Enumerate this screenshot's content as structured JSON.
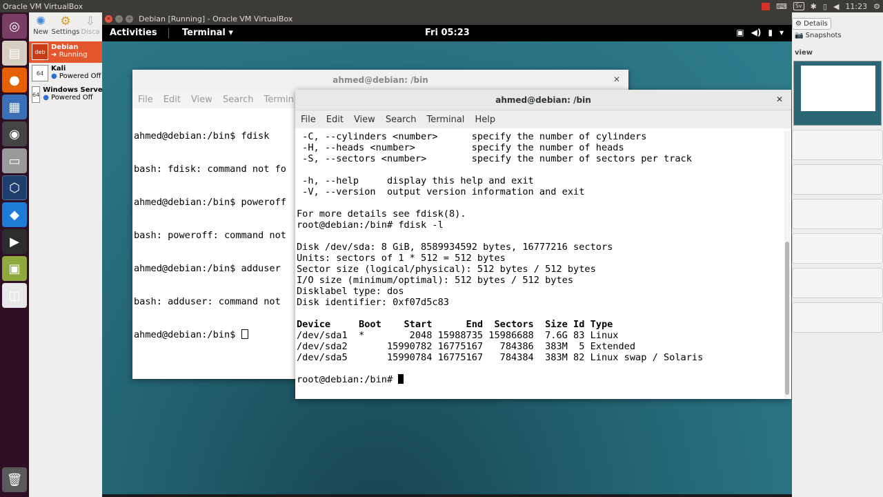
{
  "host": {
    "title": "Oracle VM VirtualBox",
    "tray": {
      "badge": "Sv",
      "time": "11:23"
    }
  },
  "launcher": {
    "items": [
      {
        "name": "ubuntu-dash-icon",
        "glyph": "◎",
        "color": "#7a3d63"
      },
      {
        "name": "files-icon",
        "glyph": "▤",
        "color": "#d7d0c2"
      },
      {
        "name": "firefox-icon",
        "glyph": "●",
        "color": "#e66000"
      },
      {
        "name": "writer-icon",
        "glyph": "▦",
        "color": "#3b6fb6"
      },
      {
        "name": "chat-icon",
        "glyph": "◉",
        "color": "#444444"
      },
      {
        "name": "disk-icon",
        "glyph": "▭",
        "color": "#9a9a9a"
      },
      {
        "name": "virtualbox-icon",
        "glyph": "⬡",
        "color": "#1d3e6e"
      },
      {
        "name": "vscode-icon",
        "glyph": "◆",
        "color": "#1e7bd6"
      },
      {
        "name": "terminal-icon",
        "glyph": "▶",
        "color": "#2c2c2c"
      },
      {
        "name": "archive-icon",
        "glyph": "▣",
        "color": "#8fa93f"
      },
      {
        "name": "pdf-icon",
        "glyph": "◫",
        "color": "#e8e8e8"
      }
    ]
  },
  "vbox": {
    "toolbar": {
      "new_label": "New",
      "settings_label": "Settings",
      "discard_label": "Disca"
    },
    "vms": [
      {
        "name": "Debian",
        "state": "Running",
        "logo": "deb"
      },
      {
        "name": "Kali",
        "state": "Powered Off",
        "logo": "64"
      },
      {
        "name": "Windows Serve",
        "state": "Powered Off",
        "logo": "64"
      }
    ],
    "right": {
      "details_tab": "Details",
      "snapshots_tab": "Snapshots",
      "preview_label": "view"
    }
  },
  "vm_window": {
    "title": "Debian [Running] - Oracle VM VirtualBox"
  },
  "gnome": {
    "activities": "Activities",
    "app_menu": "Terminal ▾",
    "clock": "Fri 05:23"
  },
  "term_back": {
    "title": "ahmed@debian: /bin",
    "menu": [
      "File",
      "Edit",
      "View",
      "Search",
      "Termin"
    ],
    "lines": [
      "ahmed@debian:/bin$ fdisk",
      "bash: fdisk: command not fo",
      "ahmed@debian:/bin$ poweroff",
      "bash: poweroff: command not",
      "ahmed@debian:/bin$ adduser",
      "bash: adduser: command not ",
      "ahmed@debian:/bin$ "
    ]
  },
  "term_front": {
    "title": "ahmed@debian: /bin",
    "menu": [
      "File",
      "Edit",
      "View",
      "Search",
      "Terminal",
      "Help"
    ],
    "lines": [
      " -C, --cylinders <number>      specify the number of cylinders",
      " -H, --heads <number>          specify the number of heads",
      " -S, --sectors <number>        specify the number of sectors per track",
      "",
      " -h, --help     display this help and exit",
      " -V, --version  output version information and exit",
      "",
      "For more details see fdisk(8).",
      "root@debian:/bin# fdisk -l",
      "",
      "Disk /dev/sda: 8 GiB, 8589934592 bytes, 16777216 sectors",
      "Units: sectors of 1 * 512 = 512 bytes",
      "Sector size (logical/physical): 512 bytes / 512 bytes",
      "I/O size (minimum/optimal): 512 bytes / 512 bytes",
      "Disklabel type: dos",
      "Disk identifier: 0xf07d5c83",
      "",
      "Device     Boot    Start      End  Sectors  Size Id Type",
      "/dev/sda1  *        2048 15988735 15986688  7.6G 83 Linux",
      "/dev/sda2       15990782 16775167   784386  383M  5 Extended",
      "/dev/sda5       15990784 16775167   784384  383M 82 Linux swap / Solaris",
      "",
      "root@debian:/bin# "
    ]
  }
}
